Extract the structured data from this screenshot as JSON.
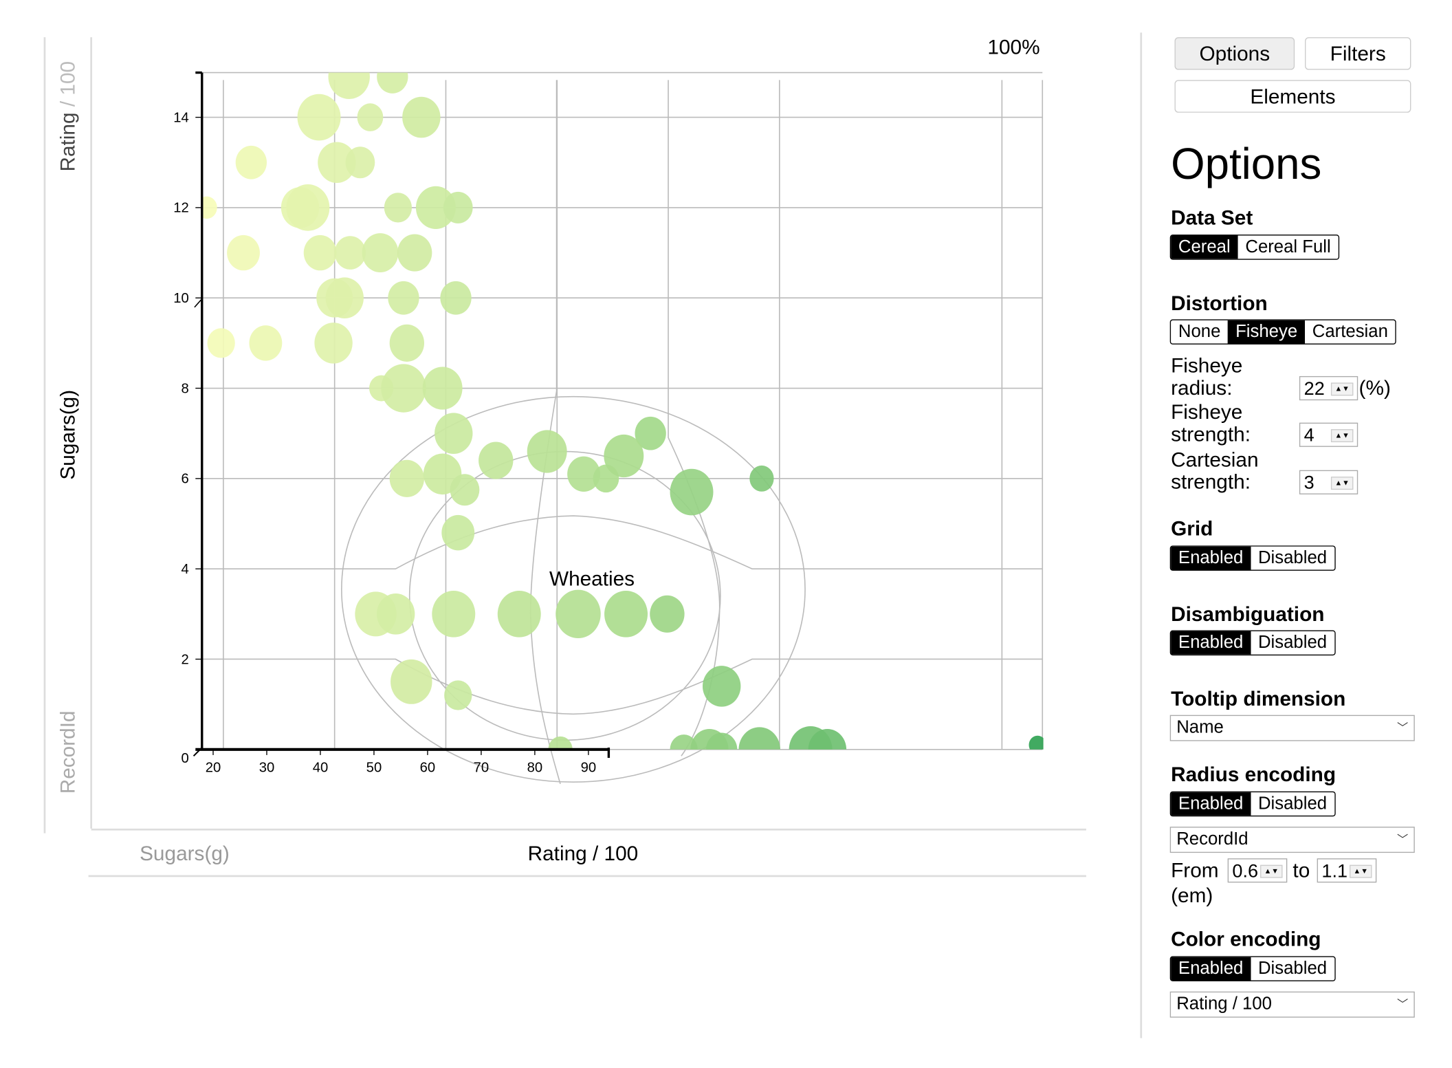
{
  "zoom_level": "100%",
  "left_axis_labels": {
    "top": {
      "main": "Rating",
      "rest": " / 100"
    },
    "middle": "Sugars(g)",
    "bottom": "RecordId"
  },
  "bottom_axis_labels": {
    "inactive": "Sugars(g)",
    "active": "Rating / 100"
  },
  "tooltip": "Wheaties",
  "panel": {
    "tabs": [
      "Options",
      "Filters",
      "Elements"
    ],
    "title": "Options",
    "data_set": {
      "label": "Data Set",
      "options": [
        "Cereal",
        "Cereal Full"
      ],
      "selected": "Cereal"
    },
    "distortion": {
      "label": "Distortion",
      "options": [
        "None",
        "Fisheye",
        "Cartesian"
      ],
      "selected": "Fisheye",
      "fisheye_radius_label": [
        "Fisheye",
        "radius:"
      ],
      "fisheye_radius": "22",
      "fisheye_radius_unit": "(%)",
      "fisheye_strength_label": [
        "Fisheye",
        "strength:"
      ],
      "fisheye_strength": "4",
      "cartesian_strength_label": [
        "Cartesian",
        "strength:"
      ],
      "cartesian_strength": "3"
    },
    "grid": {
      "label": "Grid",
      "options": [
        "Enabled",
        "Disabled"
      ],
      "selected": "Enabled"
    },
    "disambiguation": {
      "label": "Disambiguation",
      "options": [
        "Enabled",
        "Disabled"
      ],
      "selected": "Enabled"
    },
    "tooltip_dimension": {
      "label": "Tooltip dimension",
      "value": "Name"
    },
    "radius_encoding": {
      "label": "Radius encoding",
      "options": [
        "Enabled",
        "Disabled"
      ],
      "selected": "Enabled",
      "dimension": "RecordId",
      "from_label": "From",
      "from": "0.6",
      "to_label": "to",
      "to": "1.1",
      "unit": "(em)"
    },
    "color_encoding": {
      "label": "Color encoding",
      "options": [
        "Enabled",
        "Disabled"
      ],
      "selected": "Enabled",
      "dimension": "Rating / 100"
    }
  },
  "chart_data": {
    "type": "scatter",
    "xlabel": "Rating / 100",
    "ylabel": "Sugars(g)",
    "x_tick_labels": [
      "20",
      "30",
      "40",
      "50",
      "60",
      "70",
      "80",
      "90"
    ],
    "y_tick_labels": [
      "0",
      "2",
      "4",
      "6",
      "8",
      "10",
      "12",
      "14"
    ],
    "xlim": [
      18,
      95
    ],
    "ylim": [
      0,
      15
    ],
    "grid": true,
    "distortion": "fisheye",
    "color_scale": [
      "#f7fcb9",
      "#addd8e",
      "#31a354"
    ],
    "points": [
      {
        "x": 31.3,
        "y": 14.9,
        "r": 1.2
      },
      {
        "x": 35.2,
        "y": 14.9,
        "r": 0.9
      },
      {
        "x": 28.6,
        "y": 14,
        "r": 1.25
      },
      {
        "x": 33.2,
        "y": 14,
        "r": 0.75
      },
      {
        "x": 37.8,
        "y": 14,
        "r": 1.1
      },
      {
        "x": 22.5,
        "y": 13,
        "r": 0.9
      },
      {
        "x": 30.2,
        "y": 13,
        "r": 1.1
      },
      {
        "x": 32.3,
        "y": 13,
        "r": 0.85
      },
      {
        "x": 18.5,
        "y": 12,
        "r": 0.6
      },
      {
        "x": 26.9,
        "y": 12,
        "r": 1.1
      },
      {
        "x": 27.6,
        "y": 12,
        "r": 1.25
      },
      {
        "x": 35.7,
        "y": 12,
        "r": 0.8
      },
      {
        "x": 39.1,
        "y": 12,
        "r": 1.15
      },
      {
        "x": 41.1,
        "y": 12,
        "r": 0.85
      },
      {
        "x": 21.8,
        "y": 11,
        "r": 0.95
      },
      {
        "x": 28.7,
        "y": 11,
        "r": 0.95
      },
      {
        "x": 31.4,
        "y": 11,
        "r": 0.9
      },
      {
        "x": 34.1,
        "y": 11,
        "r": 1.05
      },
      {
        "x": 37.2,
        "y": 11,
        "r": 1.0
      },
      {
        "x": 30.0,
        "y": 10,
        "r": 1.05
      },
      {
        "x": 30.9,
        "y": 10,
        "r": 1.1
      },
      {
        "x": 36.2,
        "y": 10,
        "r": 0.9
      },
      {
        "x": 40.9,
        "y": 10,
        "r": 0.9
      },
      {
        "x": 19.8,
        "y": 9,
        "r": 0.8
      },
      {
        "x": 23.8,
        "y": 9,
        "r": 0.95
      },
      {
        "x": 29.9,
        "y": 9,
        "r": 1.1
      },
      {
        "x": 36.5,
        "y": 9,
        "r": 1.0
      },
      {
        "x": 34.2,
        "y": 8,
        "r": 0.7
      },
      {
        "x": 36.2,
        "y": 8,
        "r": 1.3
      },
      {
        "x": 39.7,
        "y": 8,
        "r": 1.15
      },
      {
        "x": 40.7,
        "y": 7,
        "r": 1.1
      },
      {
        "x": 58.4,
        "y": 7,
        "r": 0.9
      },
      {
        "x": 44.5,
        "y": 6.4,
        "r": 1.0
      },
      {
        "x": 49.1,
        "y": 6.6,
        "r": 1.15
      },
      {
        "x": 36.5,
        "y": 6.0,
        "r": 1.0
      },
      {
        "x": 39.7,
        "y": 6.1,
        "r": 1.1
      },
      {
        "x": 41.7,
        "y": 5.75,
        "r": 0.85
      },
      {
        "x": 52.4,
        "y": 6.1,
        "r": 0.95
      },
      {
        "x": 54.4,
        "y": 6.0,
        "r": 0.75
      },
      {
        "x": 56.0,
        "y": 6.5,
        "r": 1.15
      },
      {
        "x": 62.1,
        "y": 5.7,
        "r": 1.25
      },
      {
        "x": 68.4,
        "y": 6.0,
        "r": 0.7
      },
      {
        "x": 41.1,
        "y": 4.8,
        "r": 0.95
      },
      {
        "x": 33.7,
        "y": 3,
        "r": 1.2
      },
      {
        "x": 35.5,
        "y": 3,
        "r": 1.1
      },
      {
        "x": 40.7,
        "y": 3,
        "r": 1.25
      },
      {
        "x": 46.6,
        "y": 3,
        "r": 1.25
      },
      {
        "x": 51.9,
        "y": 3,
        "r": 1.3
      },
      {
        "x": 56.2,
        "y": 3,
        "r": 1.25
      },
      {
        "x": 59.9,
        "y": 3,
        "r": 1.0
      },
      {
        "x": 36.9,
        "y": 1.5,
        "r": 1.2
      },
      {
        "x": 41.1,
        "y": 1.2,
        "r": 0.8
      },
      {
        "x": 64.8,
        "y": 1.4,
        "r": 1.1
      },
      {
        "x": 50.3,
        "y": 0,
        "r": 0.7
      },
      {
        "x": 61.4,
        "y": 0,
        "r": 0.8
      },
      {
        "x": 63.7,
        "y": 0,
        "r": 1.1
      },
      {
        "x": 64.8,
        "y": 0,
        "r": 0.9
      },
      {
        "x": 68.2,
        "y": 0,
        "r": 1.2
      },
      {
        "x": 72.8,
        "y": 0,
        "r": 1.25
      },
      {
        "x": 74.3,
        "y": 0,
        "r": 1.1
      },
      {
        "x": 93.2,
        "y": 0.1,
        "r": 0.5
      }
    ]
  }
}
